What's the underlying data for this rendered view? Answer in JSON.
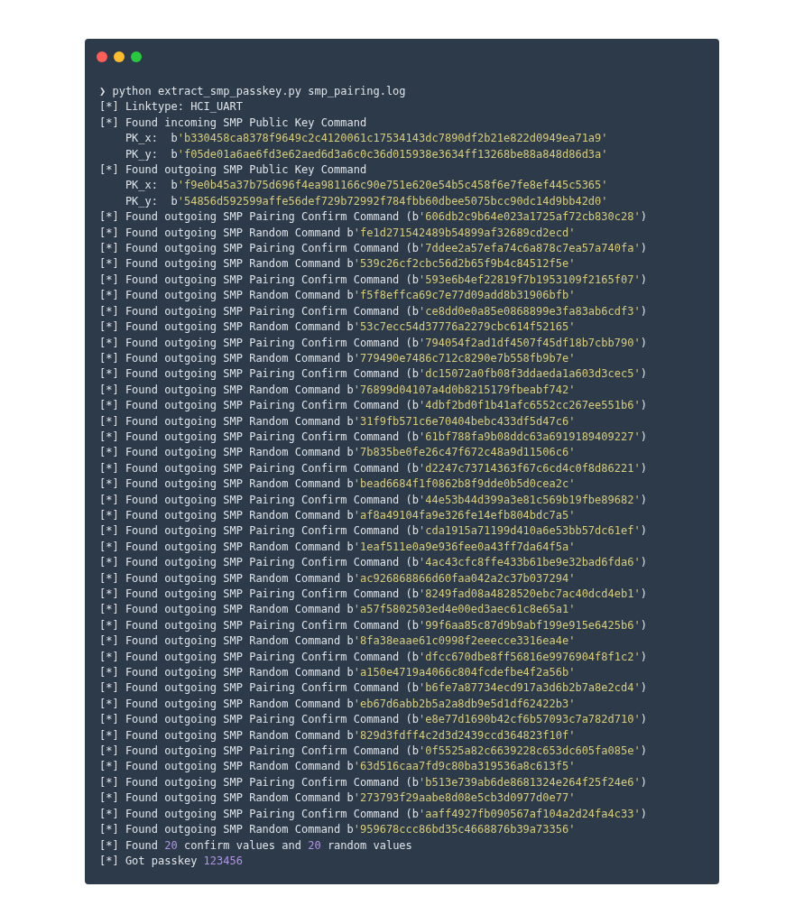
{
  "terminal": {
    "lines": [
      {
        "segments": [
          {
            "kind": "text",
            "text": "❯ python extract_smp_passkey.py smp_pairing.log"
          }
        ]
      },
      {
        "segments": [
          {
            "kind": "text",
            "text": "[*] Linktype: HCI_UART"
          }
        ]
      },
      {
        "segments": [
          {
            "kind": "text",
            "text": "[*] Found incoming SMP Public Key Command"
          }
        ]
      },
      {
        "segments": [
          {
            "kind": "text",
            "text": "    PK_x:  b"
          },
          {
            "kind": "string",
            "text": "'b330458ca8378f9649c2c4120061c17534143dc7890df2b21e822d0949ea71a9'"
          }
        ]
      },
      {
        "segments": [
          {
            "kind": "text",
            "text": "    PK_y:  b"
          },
          {
            "kind": "string",
            "text": "'f05de01a6ae6fd3e62aed6d3a6c0c36d015938e3634ff13268be88a848d86d3a'"
          }
        ]
      },
      {
        "segments": [
          {
            "kind": "text",
            "text": "[*] Found outgoing SMP Public Key Command"
          }
        ]
      },
      {
        "segments": [
          {
            "kind": "text",
            "text": "    PK_x:  b"
          },
          {
            "kind": "string",
            "text": "'f9e0b45a37b75d696f4ea981166c90e751e620e54b5c458f6e7fe8ef445c5365'"
          }
        ]
      },
      {
        "segments": [
          {
            "kind": "text",
            "text": "    PK_y:  b"
          },
          {
            "kind": "string",
            "text": "'54856d592599affe56def729b72992f784fbb60dbee5075bcc90dc14d9bb42d0'"
          }
        ]
      },
      {
        "segments": [
          {
            "kind": "text",
            "text": "[*] Found outgoing SMP Pairing Confirm Command (b"
          },
          {
            "kind": "string",
            "text": "'606db2c9b64e023a1725af72cb830c28'"
          },
          {
            "kind": "text",
            "text": ")"
          }
        ]
      },
      {
        "segments": [
          {
            "kind": "text",
            "text": "[*] Found outgoing SMP Random Command b"
          },
          {
            "kind": "string",
            "text": "'fe1d271542489b54899af32689cd2ecd'"
          }
        ]
      },
      {
        "segments": [
          {
            "kind": "text",
            "text": "[*] Found outgoing SMP Pairing Confirm Command (b"
          },
          {
            "kind": "string",
            "text": "'7ddee2a57efa74c6a878c7ea57a740fa'"
          },
          {
            "kind": "text",
            "text": ")"
          }
        ]
      },
      {
        "segments": [
          {
            "kind": "text",
            "text": "[*] Found outgoing SMP Random Command b"
          },
          {
            "kind": "string",
            "text": "'539c26cf2cbc56d2b65f9b4c84512f5e'"
          }
        ]
      },
      {
        "segments": [
          {
            "kind": "text",
            "text": "[*] Found outgoing SMP Pairing Confirm Command (b"
          },
          {
            "kind": "string",
            "text": "'593e6b4ef22819f7b1953109f2165f07'"
          },
          {
            "kind": "text",
            "text": ")"
          }
        ]
      },
      {
        "segments": [
          {
            "kind": "text",
            "text": "[*] Found outgoing SMP Random Command b"
          },
          {
            "kind": "string",
            "text": "'f5f8effca69c7e77d09add8b31906bfb'"
          }
        ]
      },
      {
        "segments": [
          {
            "kind": "text",
            "text": "[*] Found outgoing SMP Pairing Confirm Command (b"
          },
          {
            "kind": "string",
            "text": "'ce8dd0e0a85e0868899e3fa83ab6cdf3'"
          },
          {
            "kind": "text",
            "text": ")"
          }
        ]
      },
      {
        "segments": [
          {
            "kind": "text",
            "text": "[*] Found outgoing SMP Random Command b"
          },
          {
            "kind": "string",
            "text": "'53c7ecc54d37776a2279cbc614f52165'"
          }
        ]
      },
      {
        "segments": [
          {
            "kind": "text",
            "text": "[*] Found outgoing SMP Pairing Confirm Command (b"
          },
          {
            "kind": "string",
            "text": "'794054f2ad1df4507f45df18b7cbb790'"
          },
          {
            "kind": "text",
            "text": ")"
          }
        ]
      },
      {
        "segments": [
          {
            "kind": "text",
            "text": "[*] Found outgoing SMP Random Command b"
          },
          {
            "kind": "string",
            "text": "'779490e7486c712c8290e7b558fb9b7e'"
          }
        ]
      },
      {
        "segments": [
          {
            "kind": "text",
            "text": "[*] Found outgoing SMP Pairing Confirm Command (b"
          },
          {
            "kind": "string",
            "text": "'dc15072a0fb08f3ddaeda1a603d3cec5'"
          },
          {
            "kind": "text",
            "text": ")"
          }
        ]
      },
      {
        "segments": [
          {
            "kind": "text",
            "text": "[*] Found outgoing SMP Random Command b"
          },
          {
            "kind": "string",
            "text": "'76899d04107a4d0b8215179fbeabf742'"
          }
        ]
      },
      {
        "segments": [
          {
            "kind": "text",
            "text": "[*] Found outgoing SMP Pairing Confirm Command (b"
          },
          {
            "kind": "string",
            "text": "'4dbf2bd0f1b41afc6552cc267ee551b6'"
          },
          {
            "kind": "text",
            "text": ")"
          }
        ]
      },
      {
        "segments": [
          {
            "kind": "text",
            "text": "[*] Found outgoing SMP Random Command b"
          },
          {
            "kind": "string",
            "text": "'31f9fb571c6e70404bebc433df5d47c6'"
          }
        ]
      },
      {
        "segments": [
          {
            "kind": "text",
            "text": "[*] Found outgoing SMP Pairing Confirm Command (b"
          },
          {
            "kind": "string",
            "text": "'61bf788fa9b08ddc63a6919189409227'"
          },
          {
            "kind": "text",
            "text": ")"
          }
        ]
      },
      {
        "segments": [
          {
            "kind": "text",
            "text": "[*] Found outgoing SMP Random Command b"
          },
          {
            "kind": "string",
            "text": "'7b835be0fe26c47f672c48a9d11506c6'"
          }
        ]
      },
      {
        "segments": [
          {
            "kind": "text",
            "text": "[*] Found outgoing SMP Pairing Confirm Command (b"
          },
          {
            "kind": "string",
            "text": "'d2247c73714363f67c6cd4c0f8d86221'"
          },
          {
            "kind": "text",
            "text": ")"
          }
        ]
      },
      {
        "segments": [
          {
            "kind": "text",
            "text": "[*] Found outgoing SMP Random Command b"
          },
          {
            "kind": "string",
            "text": "'bead6684f1f0862b8f9dde0b5d0cea2c'"
          }
        ]
      },
      {
        "segments": [
          {
            "kind": "text",
            "text": "[*] Found outgoing SMP Pairing Confirm Command (b"
          },
          {
            "kind": "string",
            "text": "'44e53b44d399a3e81c569b19fbe89682'"
          },
          {
            "kind": "text",
            "text": ")"
          }
        ]
      },
      {
        "segments": [
          {
            "kind": "text",
            "text": "[*] Found outgoing SMP Random Command b"
          },
          {
            "kind": "string",
            "text": "'af8a49104fa9e326fe14efb804bdc7a5'"
          }
        ]
      },
      {
        "segments": [
          {
            "kind": "text",
            "text": "[*] Found outgoing SMP Pairing Confirm Command (b"
          },
          {
            "kind": "string",
            "text": "'cda1915a71199d410a6e53bb57dc61ef'"
          },
          {
            "kind": "text",
            "text": ")"
          }
        ]
      },
      {
        "segments": [
          {
            "kind": "text",
            "text": "[*] Found outgoing SMP Random Command b"
          },
          {
            "kind": "string",
            "text": "'1eaf511e0a9e936fee0a43ff7da64f5a'"
          }
        ]
      },
      {
        "segments": [
          {
            "kind": "text",
            "text": "[*] Found outgoing SMP Pairing Confirm Command (b"
          },
          {
            "kind": "string",
            "text": "'4ac43cfc8ffe433b61be9e32bad6fda6'"
          },
          {
            "kind": "text",
            "text": ")"
          }
        ]
      },
      {
        "segments": [
          {
            "kind": "text",
            "text": "[*] Found outgoing SMP Random Command b"
          },
          {
            "kind": "string",
            "text": "'ac926868866d60faa042a2c37b037294'"
          }
        ]
      },
      {
        "segments": [
          {
            "kind": "text",
            "text": "[*] Found outgoing SMP Pairing Confirm Command (b"
          },
          {
            "kind": "string",
            "text": "'8249fad08a4828520ebc7ac40dcd4eb1'"
          },
          {
            "kind": "text",
            "text": ")"
          }
        ]
      },
      {
        "segments": [
          {
            "kind": "text",
            "text": "[*] Found outgoing SMP Random Command b"
          },
          {
            "kind": "string",
            "text": "'a57f5802503ed4e00ed3aec61c8e65a1'"
          }
        ]
      },
      {
        "segments": [
          {
            "kind": "text",
            "text": "[*] Found outgoing SMP Pairing Confirm Command (b"
          },
          {
            "kind": "string",
            "text": "'99f6aa85c87d9b9abf199e915e6425b6'"
          },
          {
            "kind": "text",
            "text": ")"
          }
        ]
      },
      {
        "segments": [
          {
            "kind": "text",
            "text": "[*] Found outgoing SMP Random Command b"
          },
          {
            "kind": "string",
            "text": "'8fa38eaae61c0998f2eeecce3316ea4e'"
          }
        ]
      },
      {
        "segments": [
          {
            "kind": "text",
            "text": "[*] Found outgoing SMP Pairing Confirm Command (b"
          },
          {
            "kind": "string",
            "text": "'dfcc670dbe8ff56816e9976904f8f1c2'"
          },
          {
            "kind": "text",
            "text": ")"
          }
        ]
      },
      {
        "segments": [
          {
            "kind": "text",
            "text": "[*] Found outgoing SMP Random Command b"
          },
          {
            "kind": "string",
            "text": "'a150e4719a4066c804fcdefbe4f2a56b'"
          }
        ]
      },
      {
        "segments": [
          {
            "kind": "text",
            "text": "[*] Found outgoing SMP Pairing Confirm Command (b"
          },
          {
            "kind": "string",
            "text": "'b6fe7a87734ecd917a3d6b2b7a8e2cd4'"
          },
          {
            "kind": "text",
            "text": ")"
          }
        ]
      },
      {
        "segments": [
          {
            "kind": "text",
            "text": "[*] Found outgoing SMP Random Command b"
          },
          {
            "kind": "string",
            "text": "'eb67d6abb2b5a2a8db9e5d1df62422b3'"
          }
        ]
      },
      {
        "segments": [
          {
            "kind": "text",
            "text": "[*] Found outgoing SMP Pairing Confirm Command (b"
          },
          {
            "kind": "string",
            "text": "'e8e77d1690b42cf6b57093c7a782d710'"
          },
          {
            "kind": "text",
            "text": ")"
          }
        ]
      },
      {
        "segments": [
          {
            "kind": "text",
            "text": "[*] Found outgoing SMP Random Command b"
          },
          {
            "kind": "string",
            "text": "'829d3fdff4c2d3d2439ccd364823f10f'"
          }
        ]
      },
      {
        "segments": [
          {
            "kind": "text",
            "text": "[*] Found outgoing SMP Pairing Confirm Command (b"
          },
          {
            "kind": "string",
            "text": "'0f5525a82c6639228c653dc605fa085e'"
          },
          {
            "kind": "text",
            "text": ")"
          }
        ]
      },
      {
        "segments": [
          {
            "kind": "text",
            "text": "[*] Found outgoing SMP Random Command b"
          },
          {
            "kind": "string",
            "text": "'63d516caa7fd9c80ba319536a8c613f5'"
          }
        ]
      },
      {
        "segments": [
          {
            "kind": "text",
            "text": "[*] Found outgoing SMP Pairing Confirm Command (b"
          },
          {
            "kind": "string",
            "text": "'b513e739ab6de8681324e264f25f24e6'"
          },
          {
            "kind": "text",
            "text": ")"
          }
        ]
      },
      {
        "segments": [
          {
            "kind": "text",
            "text": "[*] Found outgoing SMP Random Command b"
          },
          {
            "kind": "string",
            "text": "'273793f29aabe8d08e5cb3d0977d0e77'"
          }
        ]
      },
      {
        "segments": [
          {
            "kind": "text",
            "text": "[*] Found outgoing SMP Pairing Confirm Command (b"
          },
          {
            "kind": "string",
            "text": "'aaff4927fb090567af104a2d24fa4c33'"
          },
          {
            "kind": "text",
            "text": ")"
          }
        ]
      },
      {
        "segments": [
          {
            "kind": "text",
            "text": "[*] Found outgoing SMP Random Command b"
          },
          {
            "kind": "string",
            "text": "'959678ccc86bd35c4668876b39a73356'"
          }
        ]
      },
      {
        "segments": [
          {
            "kind": "text",
            "text": "[*] Found "
          },
          {
            "kind": "number",
            "text": "20"
          },
          {
            "kind": "text",
            "text": " confirm values and "
          },
          {
            "kind": "number",
            "text": "20"
          },
          {
            "kind": "text",
            "text": " random values"
          }
        ]
      },
      {
        "segments": [
          {
            "kind": "text",
            "text": "[*] Got passkey "
          },
          {
            "kind": "number",
            "text": "123456"
          }
        ]
      }
    ]
  }
}
